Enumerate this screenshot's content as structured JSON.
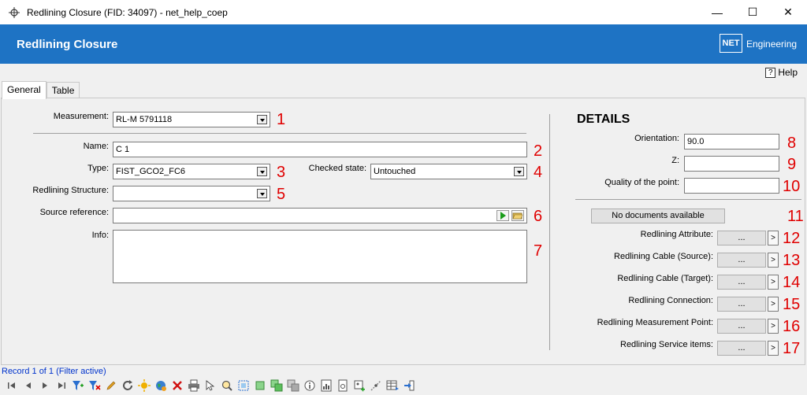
{
  "window": {
    "title": "Redlining Closure (FID: 34097) - net_help_coep",
    "minimize": "—",
    "maximize": "☐",
    "close": "✕"
  },
  "banner": {
    "title": "Redlining Closure",
    "logo_box": "NET",
    "logo_text": "Engineering"
  },
  "help": {
    "icon": "?",
    "label": "Help"
  },
  "tabs": [
    {
      "label": "General"
    },
    {
      "label": "Table"
    }
  ],
  "form": {
    "measurement": {
      "label": "Measurement:",
      "value": "RL-M 5791118"
    },
    "name": {
      "label": "Name:",
      "value": "C 1"
    },
    "type": {
      "label": "Type:",
      "value": "FIST_GCO2_FC6"
    },
    "checked_state": {
      "label": "Checked state:",
      "value": "Untouched"
    },
    "redlining_structure": {
      "label": "Redlining Structure:",
      "value": ""
    },
    "source_reference": {
      "label": "Source reference:",
      "value": ""
    },
    "info": {
      "label": "Info:",
      "value": ""
    }
  },
  "details": {
    "title": "DETAILS",
    "orientation": {
      "label": "Orientation:",
      "value": "90.0"
    },
    "z": {
      "label": "Z:",
      "value": ""
    },
    "quality": {
      "label": "Quality of the point:",
      "value": ""
    },
    "documents_button": "No documents available",
    "links": [
      {
        "label": "Redlining Attribute:",
        "button": "...",
        "arrow": ">"
      },
      {
        "label": "Redlining Cable (Source):",
        "button": "...",
        "arrow": ">"
      },
      {
        "label": "Redlining Cable (Target):",
        "button": "...",
        "arrow": ">"
      },
      {
        "label": "Redlining Connection:",
        "button": "...",
        "arrow": ">"
      },
      {
        "label": "Redlining Measurement Point:",
        "button": "...",
        "arrow": ">"
      },
      {
        "label": "Redlining Service items:",
        "button": "...",
        "arrow": ">"
      }
    ]
  },
  "annotations": [
    "1",
    "2",
    "3",
    "4",
    "5",
    "6",
    "7",
    "8",
    "9",
    "10",
    "11",
    "12",
    "13",
    "14",
    "15",
    "16",
    "17"
  ],
  "status": {
    "record": "Record 1 of 1 (Filter active)"
  },
  "colors": {
    "banner": "#1e73c4",
    "annotation": "#e00000",
    "record_text": "#0033cc"
  }
}
